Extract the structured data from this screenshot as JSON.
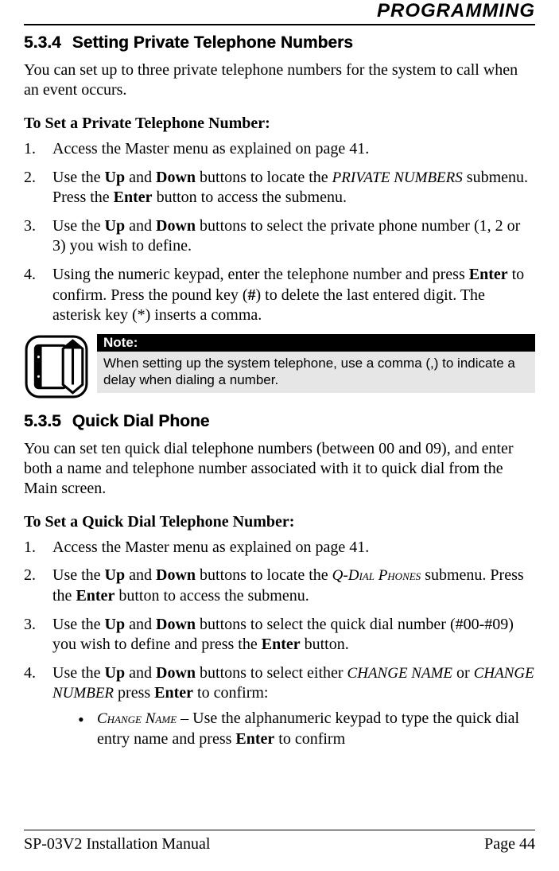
{
  "header": "PROGRAMMING",
  "section1": {
    "num": "5.3.4",
    "title": "Setting Private Telephone Numbers",
    "intro": "You can set up to three private telephone numbers for the system to call when an event occurs.",
    "subhead": "To Set a Private Telephone Number:",
    "steps": {
      "s1": "Access the Master menu as explained on page 41.",
      "s2_a": "Use the ",
      "s2_b": " and ",
      "s2_c": " buttons to locate the ",
      "s2_menu": "PRIVATE NUMBERS",
      "s2_d": " submenu.  Press the ",
      "s2_e": " button to access the submenu.",
      "s3_a": "Use the ",
      "s3_b": " and ",
      "s3_c": " buttons to select the private phone number (1, 2 or 3) you wish to define.",
      "s4_a": "Using the numeric keypad, enter the telephone number and press ",
      "s4_b": " to confirm. Press the pound key (",
      "s4_hash": "#",
      "s4_c": ") to delete the last entered digit. The asterisk key (*) inserts a comma."
    },
    "btn_up": "Up",
    "btn_down": "Down",
    "btn_enter": "Enter",
    "note_title": "Note:",
    "note_text": "When setting up the system telephone, use a comma (,) to indicate a delay when dialing a number."
  },
  "section2": {
    "num": "5.3.5",
    "title": "Quick Dial Phone",
    "intro": "You can set ten quick dial telephone numbers (between 00 and 09), and enter both a name and telephone number associated with it to quick dial from the Main screen.",
    "subhead": "To Set a Quick Dial Telephone Number:",
    "steps": {
      "s1": "Access the Master menu as explained on page 41.",
      "s2_a": "Use the ",
      "s2_b": " and ",
      "s2_c": " buttons to locate the ",
      "s2_menu": "Q-Dial Phones",
      "s2_d": " submenu.  Press the ",
      "s2_e": " button to access the submenu.",
      "s3_a": "Use the ",
      "s3_b": " and ",
      "s3_c": " buttons to select the quick dial number (#00-#09) you wish to define and press the ",
      "s3_d": " button.",
      "s4_a": "Use the ",
      "s4_b": " and ",
      "s4_c": " buttons to select either ",
      "s4_menu1": "CHANGE NAME",
      "s4_d": " or ",
      "s4_menu2": "CHANGE NUMBER",
      "s4_e": " press ",
      "s4_f": " to confirm:",
      "bullet_a": "Change Name",
      "bullet_b": " – Use the alphanumeric keypad to type the quick dial entry name and press ",
      "bullet_c": " to confirm"
    },
    "btn_up": "Up",
    "btn_down": "Down",
    "btn_enter": "Enter"
  },
  "footer": {
    "left": "SP-03V2 Installation Manual",
    "right": "Page 44"
  }
}
